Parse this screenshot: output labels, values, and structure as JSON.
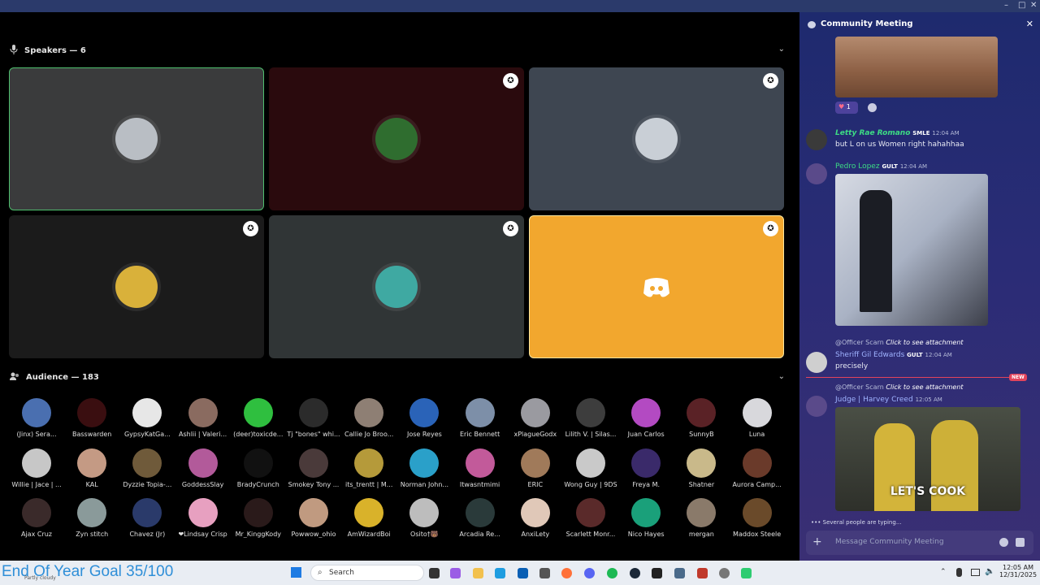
{
  "window": {
    "controls": [
      "–",
      "□",
      "✕"
    ]
  },
  "stage": {
    "speakers_heading": "Speakers — 6",
    "audience_heading": "Audience — 183",
    "discord_logo": "discord-logo",
    "speakers": [
      {
        "bg": "#3a3b3c",
        "border": "#4fbf6e",
        "avatar": "#b9bec4",
        "pinned": false
      },
      {
        "bg": "#2a0a0d",
        "border": "#2a0a0d",
        "avatar": "#2f6d2f",
        "pinned": true
      },
      {
        "bg": "#3e4651",
        "border": "#3e4651",
        "avatar": "#c9cfd6",
        "pinned": true
      },
      {
        "bg": "#1b1b1b",
        "border": "#1b1b1b",
        "avatar": "#d9b13a",
        "pinned": true
      },
      {
        "bg": "#303536",
        "border": "#303536",
        "avatar": "#3fa9a2",
        "pinned": true
      },
      {
        "bg": "#f2a72e",
        "border": "#f8e6a0",
        "avatar": "#f2a72e",
        "pinned": true
      }
    ],
    "audience": [
      {
        "name": "(Jinx) Sera...",
        "color": "#4a6fb0"
      },
      {
        "name": "Basswarden",
        "color": "#3a0e10"
      },
      {
        "name": "GypsyKatGa...",
        "color": "#e7e7e7"
      },
      {
        "name": "Ashlii | Valeri...",
        "color": "#8a6b60"
      },
      {
        "name": "(deer)toxicde...",
        "color": "#2fbf3f"
      },
      {
        "name": "Tj \"bones\" whi...",
        "color": "#2b2b2b"
      },
      {
        "name": "Callie Jo Broo...",
        "color": "#8e7f74"
      },
      {
        "name": "Jose Reyes",
        "color": "#2a63b8"
      },
      {
        "name": "Eric Bennett",
        "color": "#7d8fa8"
      },
      {
        "name": "xPlagueGodx",
        "color": "#9a9aa0"
      },
      {
        "name": "Lilith V. | Silas...",
        "color": "#3d3d3d"
      },
      {
        "name": "Juan Carlos",
        "color": "#b34ac2"
      },
      {
        "name": "SunnyB",
        "color": "#5a2226"
      },
      {
        "name": "Luna",
        "color": "#d8d8dc"
      },
      {
        "name": "Willie | Jace | ...",
        "color": "#c7c7c7"
      },
      {
        "name": "KAL",
        "color": "#c49a84"
      },
      {
        "name": "Dyzzie Topia-...",
        "color": "#6f5a3a"
      },
      {
        "name": "GoddessSlay",
        "color": "#b25a9a"
      },
      {
        "name": "BradyCrunch",
        "color": "#111111"
      },
      {
        "name": "Smokey Tony ...",
        "color": "#4a3a3a"
      },
      {
        "name": "its_trentt | M...",
        "color": "#b59a3a"
      },
      {
        "name": "Norman John...",
        "color": "#2aa0c9"
      },
      {
        "name": "Itwasntmimi",
        "color": "#c25a9a"
      },
      {
        "name": "ERIC",
        "color": "#a07a5a"
      },
      {
        "name": "Wong Guy | 9DS",
        "color": "#c9c9c9"
      },
      {
        "name": "Freya M.",
        "color": "#3a2a6a"
      },
      {
        "name": "Shatner",
        "color": "#c9b98a"
      },
      {
        "name": "Aurora Camp...",
        "color": "#6a3a2a"
      },
      {
        "name": "Ajax Cruz",
        "color": "#3a2a2a"
      },
      {
        "name": "Zyn stitch",
        "color": "#8a9a9a"
      },
      {
        "name": "Chavez (Jr)",
        "color": "#2a3a6a"
      },
      {
        "name": "❤Lindsay Crisp",
        "color": "#e7a0c0"
      },
      {
        "name": "Mr_KinggKody",
        "color": "#2a1a1a"
      },
      {
        "name": "Powwow_ohio",
        "color": "#c09a80"
      },
      {
        "name": "AmWizardBoi",
        "color": "#d9b22a"
      },
      {
        "name": "Osito†🐻",
        "color": "#bdbdbd"
      },
      {
        "name": "Arcadia Re...",
        "color": "#2a3a3a"
      },
      {
        "name": "AnxiLety",
        "color": "#e0c8b8"
      },
      {
        "name": "Scarlett Monr...",
        "color": "#5a2a2a"
      },
      {
        "name": "Nico Hayes",
        "color": "#1aa07a"
      },
      {
        "name": "mergan",
        "color": "#8a7a6a"
      },
      {
        "name": "Maddox Steele",
        "color": "#6a4a2a"
      }
    ]
  },
  "chat": {
    "title": "Community Meeting",
    "reaction_count": "1",
    "messages": [
      {
        "user": "Letty Rae Romano",
        "user_color": "#3ddc84",
        "tag": "SMLE",
        "time": "12:04 AM",
        "text": "but L on us Women right hahahhaa"
      },
      {
        "user": "Pedro Lopez",
        "user_color": "#3ddc84",
        "tag": "GULT",
        "time": "12:04 AM",
        "text": ""
      },
      {
        "reply_user": "@Officer Scarn",
        "reply_text": "Click to see attachment",
        "user": "Sheriff Gil Edwards",
        "user_color": "#9fb3ff",
        "tag": "GULT",
        "time": "12:04 AM",
        "text": "precisely"
      },
      {
        "reply_user": "@Officer Scarn",
        "reply_text": "Click to see attachment",
        "user": "Judge | Harvey Creed",
        "user_color": "#9fb3ff",
        "tag": "",
        "time": "12:05 AM",
        "text": ""
      }
    ],
    "new_badge": "NEW",
    "gif_caption": "LET'S COOK",
    "typing": "Several people are typing...",
    "composer_placeholder": "Message Community Meeting"
  },
  "taskbar": {
    "overlay_text": "End Of Year Goal 35/100",
    "weather": "Partly cloudy",
    "search_label": "Search",
    "time": "12:05 AM",
    "date": "12/31/2025"
  }
}
